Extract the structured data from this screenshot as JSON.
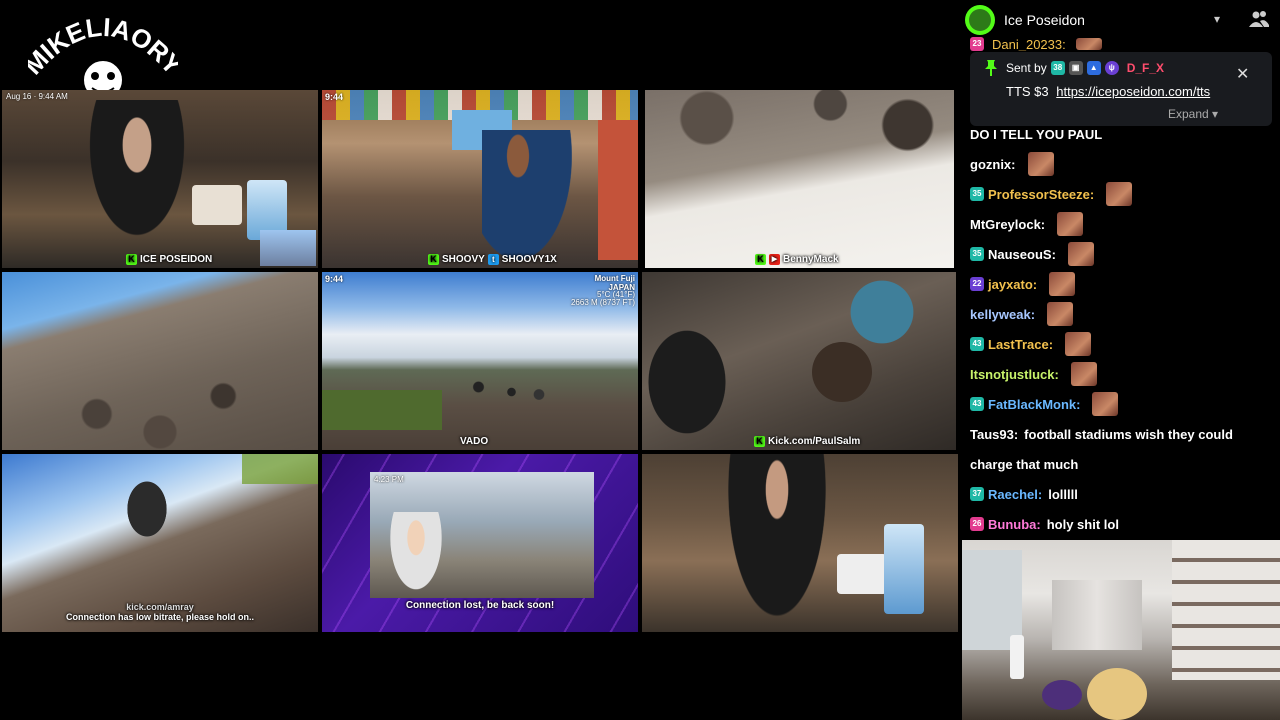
{
  "logo": {
    "text": "MIKELIAORY"
  },
  "grid": {
    "tiles": [
      {
        "label": "ICE POSEIDON",
        "hud": "Aug 16 · 9:44 AM"
      },
      {
        "label_left": "SHOOVY",
        "label_right": "SHOOVY1X",
        "time": "9:44"
      },
      {
        "label": "BennyMack"
      },
      {
        "label": ""
      },
      {
        "time": "9:44",
        "location": "Mount Fuji",
        "country": "JAPAN",
        "elev": "2663 M (8737 FT)",
        "temp": "5°C (41°F)",
        "label": "VADO"
      },
      {
        "label": "Kick.com/PaulSalm"
      },
      {
        "caption": "Connection has low bitrate, please hold on..",
        "link": "kick.com/amray"
      },
      {
        "time": "4:23 PM",
        "caption": "Connection lost, be back soon!"
      },
      {
        "label": ""
      }
    ]
  },
  "chat": {
    "channel_name": "Ice Poseidon",
    "pinned_partial_user": "Dani_20233:",
    "pinned": {
      "sent_by_label": "Sent by",
      "sender": "D_F_X",
      "message": "TTS $3",
      "link": "https://iceposeidon.com/tts",
      "expand_label": "Expand"
    },
    "messages": [
      {
        "user": "",
        "text": "DO I TELL YOU PAUL",
        "color": "#ffffff"
      },
      {
        "user": "goznix:",
        "text": "",
        "color": "#ffffff",
        "emote": true
      },
      {
        "badge": "35",
        "user": "ProfessorSteeze:",
        "text": "",
        "color": "#f2c14e",
        "emote": true
      },
      {
        "user": "MtGreylock:",
        "text": "",
        "color": "#ffffff",
        "emote": true
      },
      {
        "badge": "35",
        "user": "NauseouS:",
        "text": "",
        "color": "#ffffff",
        "emote": true
      },
      {
        "badge": "22",
        "user": "jayxato:",
        "text": "",
        "color": "#f2c14e",
        "emote": true
      },
      {
        "user": "kellyweak:",
        "text": "",
        "color": "#a7c7ff",
        "emote": true
      },
      {
        "badge": "43",
        "user": "LastTrace:",
        "text": "",
        "color": "#f2c14e",
        "emote": true
      },
      {
        "user": "Itsnotjustluck:",
        "text": "",
        "color": "#c7f26a",
        "emote": true
      },
      {
        "badge": "43",
        "user": "FatBlackMonk:",
        "text": "",
        "color": "#6ab8ff",
        "emote": true
      },
      {
        "user": "Taus93:",
        "text": "football stadiums wish they could",
        "color": "#ffffff"
      },
      {
        "user": "",
        "text": "charge that much",
        "color": "#ffffff"
      },
      {
        "badge": "37",
        "user": "Raechel:",
        "text": "lolllll",
        "color": "#6ab8ff"
      },
      {
        "badge": "26",
        "user": "Bunuba:",
        "text": "holy shit lol",
        "color": "#ff7ad9"
      }
    ]
  },
  "colors": {
    "kick_green": "#53fc18",
    "pinned_bg": "#191b1f",
    "badge_teal": "#1fb8a6",
    "badge_pink": "#e23b8f"
  }
}
